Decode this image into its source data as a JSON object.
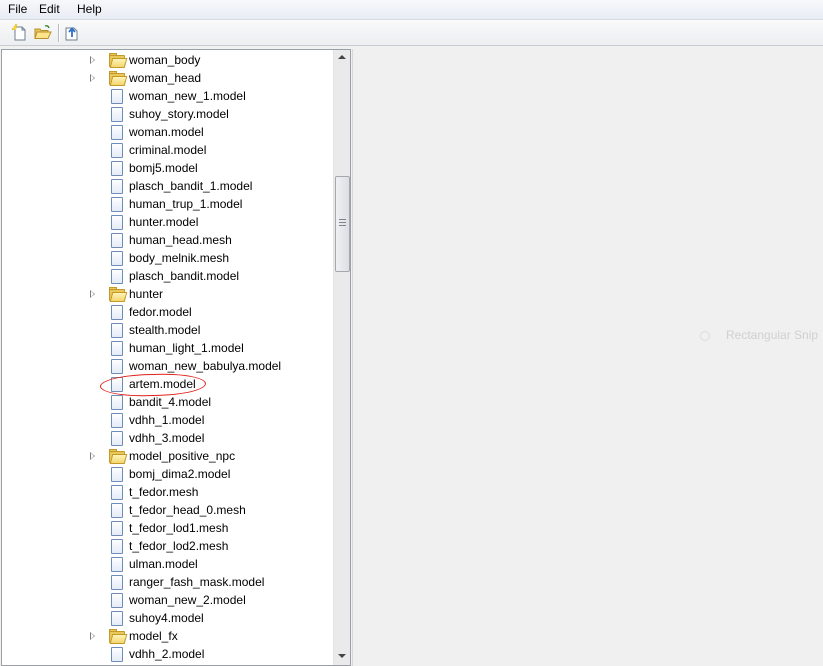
{
  "menubar": {
    "items": [
      "File",
      "Edit",
      "Help"
    ]
  },
  "toolbar": {
    "buttons": [
      {
        "name": "new-file-icon"
      },
      {
        "name": "open-folder-icon"
      },
      {
        "name": "export-icon"
      }
    ]
  },
  "tree": {
    "items": [
      {
        "label": "woman_body",
        "type": "folder"
      },
      {
        "label": "woman_head",
        "type": "folder"
      },
      {
        "label": "woman_new_1.model",
        "type": "file"
      },
      {
        "label": "suhoy_story.model",
        "type": "file"
      },
      {
        "label": "woman.model",
        "type": "file"
      },
      {
        "label": "criminal.model",
        "type": "file"
      },
      {
        "label": "bomj5.model",
        "type": "file"
      },
      {
        "label": "plasch_bandit_1.model",
        "type": "file"
      },
      {
        "label": "human_trup_1.model",
        "type": "file"
      },
      {
        "label": "hunter.model",
        "type": "file"
      },
      {
        "label": "human_head.mesh",
        "type": "file"
      },
      {
        "label": "body_melnik.mesh",
        "type": "file"
      },
      {
        "label": "plasch_bandit.model",
        "type": "file"
      },
      {
        "label": "hunter",
        "type": "folder"
      },
      {
        "label": "fedor.model",
        "type": "file"
      },
      {
        "label": "stealth.model",
        "type": "file"
      },
      {
        "label": "human_light_1.model",
        "type": "file"
      },
      {
        "label": "woman_new_babulya.model",
        "type": "file"
      },
      {
        "label": "artem.model",
        "type": "file",
        "highlighted": true
      },
      {
        "label": "bandit_4.model",
        "type": "file"
      },
      {
        "label": "vdhh_1.model",
        "type": "file"
      },
      {
        "label": "vdhh_3.model",
        "type": "file"
      },
      {
        "label": "model_positive_npc",
        "type": "folder"
      },
      {
        "label": "bomj_dima2.model",
        "type": "file"
      },
      {
        "label": "t_fedor.mesh",
        "type": "file"
      },
      {
        "label": "t_fedor_head_0.mesh",
        "type": "file"
      },
      {
        "label": "t_fedor_lod1.mesh",
        "type": "file"
      },
      {
        "label": "t_fedor_lod2.mesh",
        "type": "file"
      },
      {
        "label": "ulman.model",
        "type": "file"
      },
      {
        "label": "ranger_fash_mask.model",
        "type": "file"
      },
      {
        "label": "woman_new_2.model",
        "type": "file"
      },
      {
        "label": "suhoy4.model",
        "type": "file"
      },
      {
        "label": "model_fx",
        "type": "folder"
      },
      {
        "label": "vdhh_2.model",
        "type": "file"
      }
    ]
  },
  "overlay": {
    "ghost_label": "Rectangular Snip"
  },
  "colors": {
    "annotation": "#e0201a",
    "folder": "#e9c85a",
    "file_border": "#6f8cb7"
  }
}
